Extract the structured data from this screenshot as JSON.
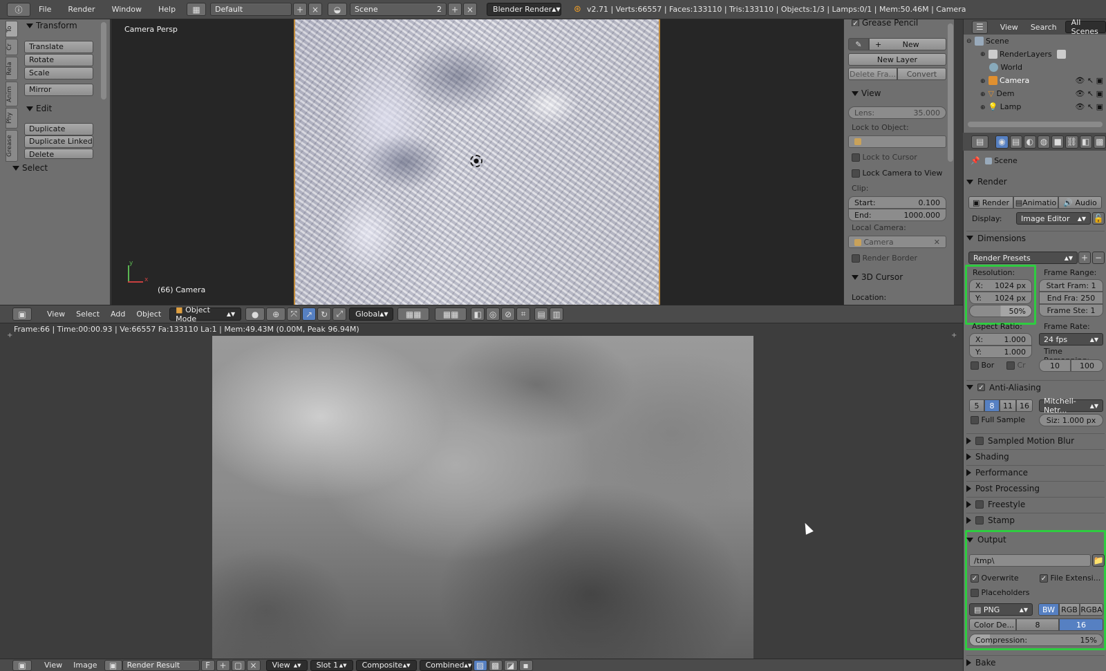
{
  "topbar": {
    "info_icon": "info-icon",
    "menus": [
      "File",
      "Render",
      "Window",
      "Help"
    ],
    "layout_name": "Default",
    "scene_name": "Scene",
    "scene_users": "2",
    "engine": "Blender Render",
    "stats": "v2.71 | Verts:66557 | Faces:133110 | Tris:133110 | Objects:1/3 | Lamps:0/1 | Mem:50.46M | Camera"
  },
  "toolshelf": {
    "tabs": [
      "To",
      "Cr",
      "Rela",
      "Anim",
      "Phy",
      "Grease"
    ],
    "transform_header": "Transform",
    "transform_buttons": [
      "Translate",
      "Rotate",
      "Scale"
    ],
    "mirror": "Mirror",
    "edit_header": "Edit",
    "edit_buttons": [
      "Duplicate",
      "Duplicate Linked",
      "Delete"
    ],
    "select_header": "Select"
  },
  "viewport": {
    "view_label": "Camera Persp",
    "object_label": "(66) Camera",
    "axis_y": "y",
    "axis_x": "x"
  },
  "npanel": {
    "grease_pencil": "Grease Pencil",
    "new": "New",
    "new_layer": "New Layer",
    "delete_frame": "Delete Fra...",
    "convert": "Convert",
    "view_header": "View",
    "lens_label": "Lens:",
    "lens_value": "35.000",
    "lock_to_object": "Lock to Object:",
    "lock_to_cursor": "Lock to Cursor",
    "lock_camera": "Lock Camera to View",
    "clip": "Clip:",
    "start_label": "Start:",
    "start_value": "0.100",
    "end_label": "End:",
    "end_value": "1000.000",
    "local_camera": "Local Camera:",
    "camera": "Camera",
    "render_border": "Render Border",
    "cursor_header": "3D Cursor",
    "location": "Location:"
  },
  "vp_header": {
    "menus": [
      "View",
      "Select",
      "Add",
      "Object"
    ],
    "mode": "Object Mode",
    "orientation": "Global"
  },
  "image_editor": {
    "status": "Frame:66 | Time:00:00.93 | Ve:66557 Fa:133110 La:1 | Mem:49.43M (0.00M, Peak 96.94M)"
  },
  "bottombar": {
    "menus": [
      "View",
      "Image"
    ],
    "image_name": "Render Result",
    "f_label": "F",
    "view": "View",
    "slot": "Slot 1",
    "composite": "Composite",
    "combined": "Combined"
  },
  "outliner": {
    "menus": [
      "View",
      "Search"
    ],
    "all_scenes": "All Scenes",
    "items": [
      "Scene",
      "RenderLayers",
      "World",
      "Camera",
      "Dem",
      "Lamp"
    ]
  },
  "properties": {
    "scene": "Scene",
    "render_header": "Render",
    "render_btn": "Render",
    "anim_btn": "Animatio",
    "audio_btn": "Audio",
    "display_label": "Display:",
    "display_value": "Image Editor",
    "dimensions_header": "Dimensions",
    "render_presets": "Render Presets",
    "resolution_label": "Resolution:",
    "res_x_label": "X:",
    "res_x": "1024 px",
    "res_y_label": "Y:",
    "res_y": "1024 px",
    "res_pct": "50%",
    "frame_range_label": "Frame Range:",
    "start_frame": "Start Fram: 1",
    "end_frame": "End Fra: 250",
    "frame_step": "Frame Ste: 1",
    "aspect_label": "Aspect Ratio:",
    "aspect_x_label": "X:",
    "aspect_x": "1.000",
    "aspect_y_label": "Y:",
    "aspect_y": "1.000",
    "frame_rate_label": "Frame Rate:",
    "fps": "24 fps",
    "time_remap_label": "Time Remapping:",
    "remap_old": "10",
    "remap_new": "100",
    "bor": "Bor",
    "cr": "Cr",
    "aa_header": "Anti-Aliasing",
    "aa_samples": [
      "5",
      "8",
      "11",
      "16"
    ],
    "aa_filter": "Mitchell-Netr...",
    "full_sample": "Full Sample",
    "filter_size": "Siz: 1.000 px",
    "motion_blur": "Sampled Motion Blur",
    "shading": "Shading",
    "performance": "Performance",
    "post_processing": "Post Processing",
    "freestyle": "Freestyle",
    "stamp": "Stamp",
    "output_header": "Output",
    "output_path": "/tmp\\",
    "overwrite": "Overwrite",
    "file_ext": "File Extensi...",
    "placeholders": "Placeholders",
    "format": "PNG",
    "color_modes": [
      "BW",
      "RGB",
      "RGBA"
    ],
    "color_depth_label": "Color De...",
    "depth_8": "8",
    "depth_16": "16",
    "compression_label": "Compression:",
    "compression_value": "15%",
    "bake": "Bake"
  },
  "colors": {
    "highlight": "#2ecc40",
    "selected_blue": "#5680c2"
  }
}
